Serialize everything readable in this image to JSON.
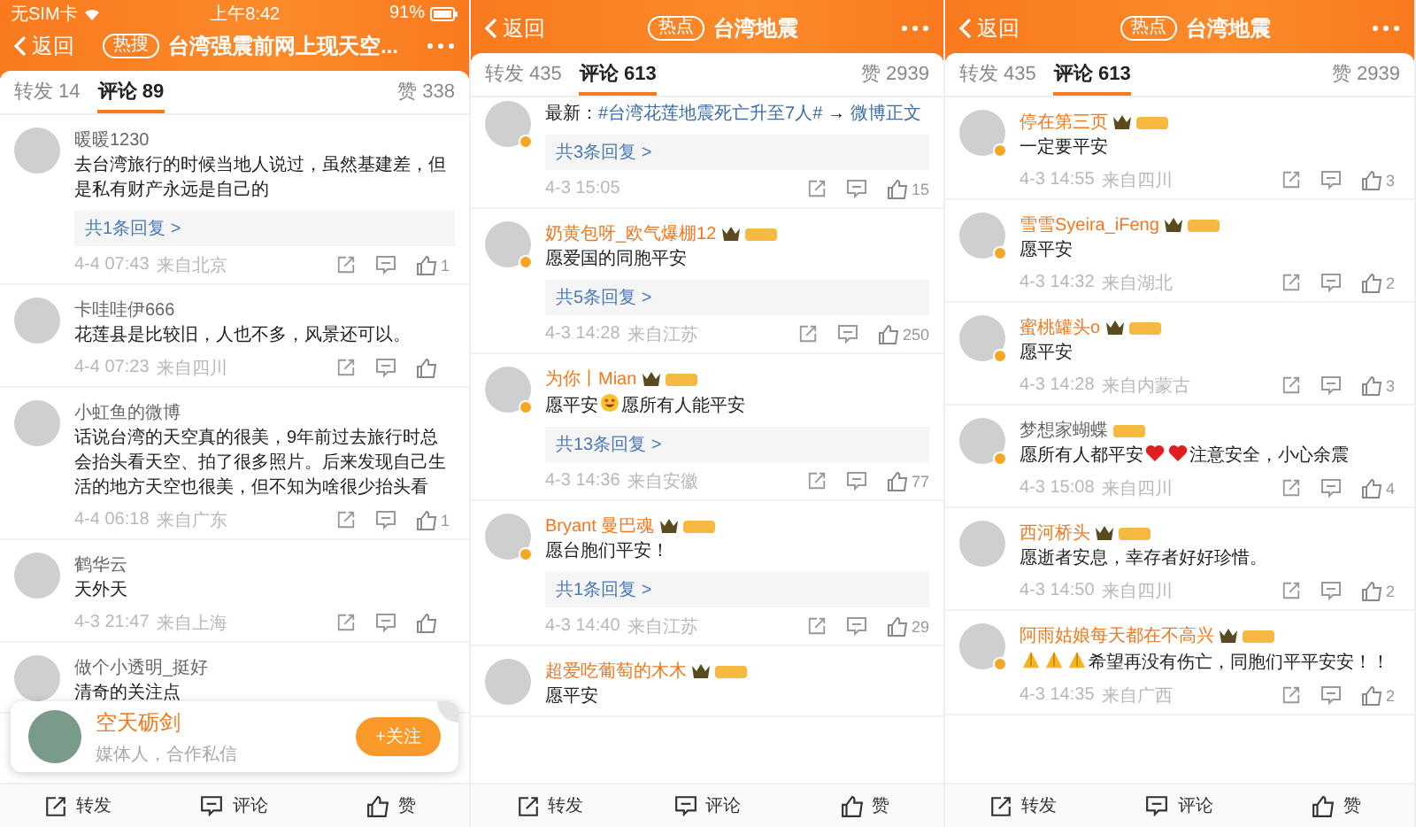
{
  "panels": [
    {
      "status_bar": {
        "carrier": "无SIM卡",
        "time": "上午8:42",
        "battery": "91%"
      },
      "header": {
        "back": "返回",
        "tag": "热搜",
        "title": "台湾强震前网上现天空..."
      },
      "tabs": [
        {
          "label": "转发 14",
          "selected": false
        },
        {
          "label": "评论 89",
          "selected": true
        },
        {
          "label": "赞 338",
          "selected": false
        }
      ],
      "comments": [
        {
          "name": "暖暖1230",
          "vip": false,
          "crown": false,
          "level_badge": false,
          "verified": false,
          "body": [
            {
              "kind": "text",
              "text": "去台湾旅行的时候当地人说过，虽然基建差，但是私有财产永远是自己的"
            }
          ],
          "replies": "共1条回复 >",
          "time": "4-4 07:43",
          "location": "来自北京",
          "likes": "1"
        },
        {
          "name": "卡哇哇伊666",
          "vip": false,
          "crown": false,
          "level_badge": false,
          "verified": false,
          "body": [
            {
              "kind": "text",
              "text": "花莲县是比较旧，人也不多，风景还可以。"
            }
          ],
          "time": "4-4 07:23",
          "location": "来自四川"
        },
        {
          "name": "小虹鱼的微博",
          "vip": false,
          "crown": false,
          "level_badge": false,
          "verified": false,
          "body": [
            {
              "kind": "text",
              "text": "话说台湾的天空真的很美，9年前过去旅行时总会抬头看天空、拍了很多照片。后来发现自己生活的地方天空也很美，但不知为啥很少抬头看"
            }
          ],
          "time": "4-4 06:18",
          "location": "来自广东",
          "likes": "1"
        },
        {
          "name": "鹤华云",
          "vip": false,
          "crown": false,
          "level_badge": false,
          "verified": false,
          "body": [
            {
              "kind": "text",
              "text": "天外天"
            }
          ],
          "time": "4-3 21:47",
          "location": "来自上海"
        },
        {
          "name": "做个小透明_挺好",
          "vip": false,
          "crown": false,
          "level_badge": false,
          "verified": false,
          "body": [
            {
              "kind": "text",
              "text": "清奇的关注点"
            }
          ]
        }
      ],
      "popup": {
        "name": "空天砺剑",
        "subtitle": "媒体人，合作私信",
        "button": "+关注"
      },
      "bottom_bar": [
        {
          "kind": "share",
          "label": "转发"
        },
        {
          "kind": "comment",
          "label": "评论"
        },
        {
          "kind": "like",
          "label": "赞"
        }
      ]
    },
    {
      "header": {
        "back": "返回",
        "tag": "热点",
        "title": "台湾地震"
      },
      "tabs": [
        {
          "label": "转发 435",
          "selected": false
        },
        {
          "label": "评论 613",
          "selected": true
        },
        {
          "label": "赞 2939",
          "selected": false
        }
      ],
      "comments": [
        {
          "verified": true,
          "body": [
            {
              "kind": "text",
              "text": "最新："
            },
            {
              "kind": "link",
              "text": "#台湾花莲地震死亡升至7人#"
            },
            {
              "kind": "text",
              "text": " → "
            },
            {
              "kind": "link",
              "text": "微博正文"
            }
          ],
          "replies": "共3条回复 >",
          "time": "4-3 15:05",
          "likes": "15"
        },
        {
          "name": "奶黄包呀_欧气爆棚12",
          "vip": true,
          "crown": true,
          "level_badge": true,
          "verified": true,
          "body": [
            {
              "kind": "text",
              "text": "愿爱国的同胞平安"
            }
          ],
          "replies": "共5条回复 >",
          "time": "4-3 14:28",
          "location": "来自江苏",
          "likes": "250"
        },
        {
          "name": "为你丨Mian",
          "vip": true,
          "crown": true,
          "level_badge": true,
          "verified": true,
          "body": [
            {
              "kind": "text",
              "text": "愿平安"
            },
            {
              "kind": "grin"
            },
            {
              "kind": "text",
              "text": "愿所有人能平安"
            }
          ],
          "replies": "共13条回复 >",
          "time": "4-3 14:36",
          "location": "来自安徽",
          "likes": "77"
        },
        {
          "name": "Bryant 曼巴魂",
          "vip": true,
          "crown": true,
          "level_badge": true,
          "verified": true,
          "body": [
            {
              "kind": "text",
              "text": "愿台胞们平安！"
            }
          ],
          "replies": "共1条回复 >",
          "time": "4-3 14:40",
          "location": "来自江苏",
          "likes": "29"
        },
        {
          "name": "超爱吃葡萄的木木",
          "vip": true,
          "crown": true,
          "level_badge": true,
          "verified": false,
          "body": [
            {
              "kind": "text",
              "text": "愿平安"
            }
          ]
        }
      ],
      "bottom_bar": [
        {
          "kind": "share",
          "label": "转发"
        },
        {
          "kind": "comment",
          "label": "评论"
        },
        {
          "kind": "like",
          "label": "赞"
        }
      ]
    },
    {
      "header": {
        "back": "返回",
        "tag": "热点",
        "title": "台湾地震"
      },
      "tabs": [
        {
          "label": "转发 435",
          "selected": false
        },
        {
          "label": "评论 613",
          "selected": true
        },
        {
          "label": "赞 2939",
          "selected": false
        }
      ],
      "comments": [
        {
          "name": "停在第三页",
          "vip": true,
          "crown": true,
          "level_badge": true,
          "verified": true,
          "body": [
            {
              "kind": "text",
              "text": "一定要平安"
            }
          ],
          "time": "4-3 14:55",
          "location": "来自四川",
          "likes": "3"
        },
        {
          "name": "雪雪Syeira_iFeng",
          "vip": true,
          "crown": true,
          "level_badge": true,
          "verified": true,
          "body": [
            {
              "kind": "text",
              "text": "愿平安"
            }
          ],
          "time": "4-3 14:32",
          "location": "来自湖北",
          "likes": "2"
        },
        {
          "name": "蜜桃罐头o",
          "vip": true,
          "crown": true,
          "level_badge": true,
          "verified": true,
          "body": [
            {
              "kind": "text",
              "text": "愿平安"
            }
          ],
          "time": "4-3 14:28",
          "location": "来自内蒙古",
          "likes": "3"
        },
        {
          "name": "梦想家蝴蝶",
          "vip": false,
          "crown": false,
          "level_badge": true,
          "verified": true,
          "body": [
            {
              "kind": "text",
              "text": "愿所有人都平安"
            },
            {
              "kind": "heart"
            },
            {
              "kind": "heart"
            },
            {
              "kind": "text",
              "text": "注意安全，小心余震"
            }
          ],
          "time": "4-3 15:08",
          "location": "来自四川",
          "likes": "4"
        },
        {
          "name": "西河桥头",
          "vip": true,
          "crown": true,
          "level_badge": true,
          "verified": false,
          "body": [
            {
              "kind": "text",
              "text": "愿逝者安息，幸存者好好珍惜。"
            }
          ],
          "time": "4-3 14:50",
          "location": "来自四川",
          "likes": "2"
        },
        {
          "name": "阿雨姑娘每天都在不高兴",
          "vip": true,
          "crown": true,
          "level_badge": true,
          "verified": true,
          "body": [
            {
              "kind": "pray"
            },
            {
              "kind": "pray"
            },
            {
              "kind": "pray"
            },
            {
              "kind": "text",
              "text": "希望再没有伤亡，同胞们平平安安！！"
            }
          ],
          "time": "4-3 14:35",
          "location": "来自广西",
          "likes": "2"
        }
      ],
      "bottom_bar": [
        {
          "kind": "share",
          "label": "转发"
        },
        {
          "kind": "comment",
          "label": "评论"
        },
        {
          "kind": "like",
          "label": "赞"
        }
      ]
    }
  ]
}
